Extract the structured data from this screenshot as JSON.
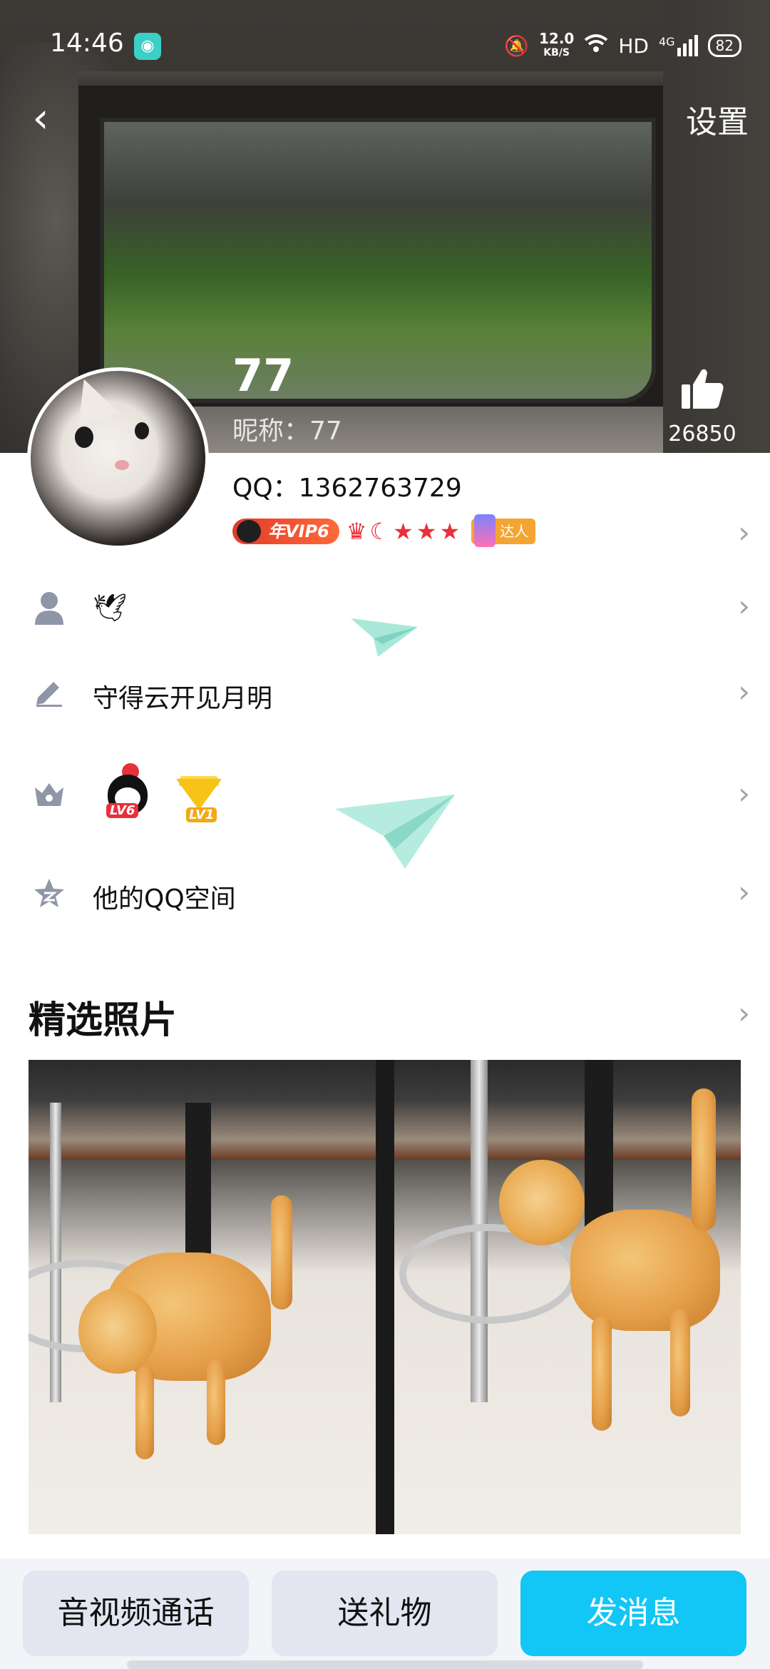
{
  "status_bar": {
    "time": "14:46",
    "net_speed": "12.0",
    "net_unit": "KB/S",
    "hd_label": "HD",
    "signal_label": "4G",
    "battery": "82"
  },
  "nav": {
    "back_icon": "back-chevron-icon",
    "settings_label": "设置"
  },
  "profile": {
    "name": "77",
    "nickname_label": "昵称：",
    "nickname_value": "77",
    "qq_label": "QQ：",
    "qq_number": "1362763729",
    "likes": "26850",
    "vip_badge": "年VIP6",
    "expert_badge": "达人",
    "level_icons": "crown, moon, 3 stars"
  },
  "rows": {
    "signature_icon": "person-icon",
    "signature_emoji": "🕊",
    "status_icon": "pencil-icon",
    "status_text": "守得云开见月明",
    "badge_icon": "crown-icon",
    "qq_level": "LV6",
    "vip_level": "LV1",
    "qzone_icon": "qzone-star-icon",
    "qzone_text": "他的QQ空间"
  },
  "photos": {
    "section_title": "精选照片"
  },
  "actions": {
    "call": "音视频通话",
    "gift": "送礼物",
    "message": "发消息"
  },
  "colors": {
    "accent": "#12c6f5",
    "secondary_button": "#e3e6f0",
    "vip_red": "#e23a28"
  }
}
